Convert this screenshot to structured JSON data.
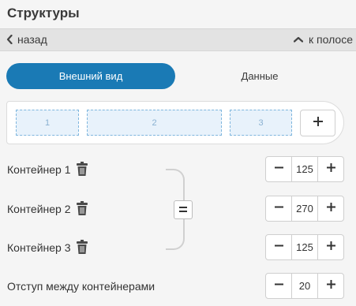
{
  "header": {
    "title": "Структуры"
  },
  "nav": {
    "back_label": "назад",
    "up_label": "к полосе"
  },
  "tabs": [
    {
      "label": "Внешний вид",
      "active": true
    },
    {
      "label": "Данные",
      "active": false
    }
  ],
  "preview": {
    "containers": [
      "1",
      "2",
      "3"
    ],
    "add_label": "+"
  },
  "rows": [
    {
      "label": "Контейнер 1",
      "value": "125"
    },
    {
      "label": "Контейнер 2",
      "value": "270"
    },
    {
      "label": "Контейнер 3",
      "value": "125"
    },
    {
      "label": "Отступ между контейнерами",
      "value": "20"
    }
  ],
  "equalize": {
    "label": "="
  },
  "colors": {
    "accent": "#1a7ab5",
    "container_fill": "#e8f2fb",
    "container_border": "#7fb6de"
  },
  "icons": {
    "back": "chevron-left-icon",
    "up": "chevron-up-icon",
    "trash": "trash-icon",
    "plus": "plus-icon",
    "minus": "minus-icon"
  }
}
